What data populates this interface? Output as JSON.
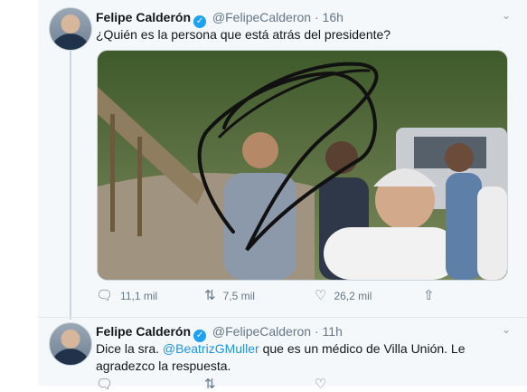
{
  "tweets": [
    {
      "name": "Felipe Calderón",
      "handle": "@FelipeCalderon",
      "separator": "·",
      "time": "16h",
      "text": "¿Quién es la persona que está atrás del presidente?",
      "stats": {
        "replies": "11,1 mil",
        "retweets": "7,5 mil",
        "likes": "26,2 mil"
      }
    },
    {
      "name": "Felipe Calderón",
      "handle": "@FelipeCalderon",
      "separator": "·",
      "time": "11h",
      "text_before": "Dice la sra. ",
      "mention": "@BeatrizGMuller",
      "text_after": " que es un médico de Villa Unión. Le agradezco la respuesta.",
      "stats": {
        "replies": "",
        "retweets": "",
        "likes": ""
      }
    }
  ],
  "icons": {
    "verified": "verified-badge-icon",
    "caret": "chevron-down-icon",
    "reply": "reply-icon",
    "retweet": "retweet-icon",
    "like": "heart-icon",
    "share": "share-icon"
  },
  "colors": {
    "link": "#1b95e0",
    "verified": "#1da1f2",
    "meta": "#657786",
    "background": "#f5f8fa"
  }
}
